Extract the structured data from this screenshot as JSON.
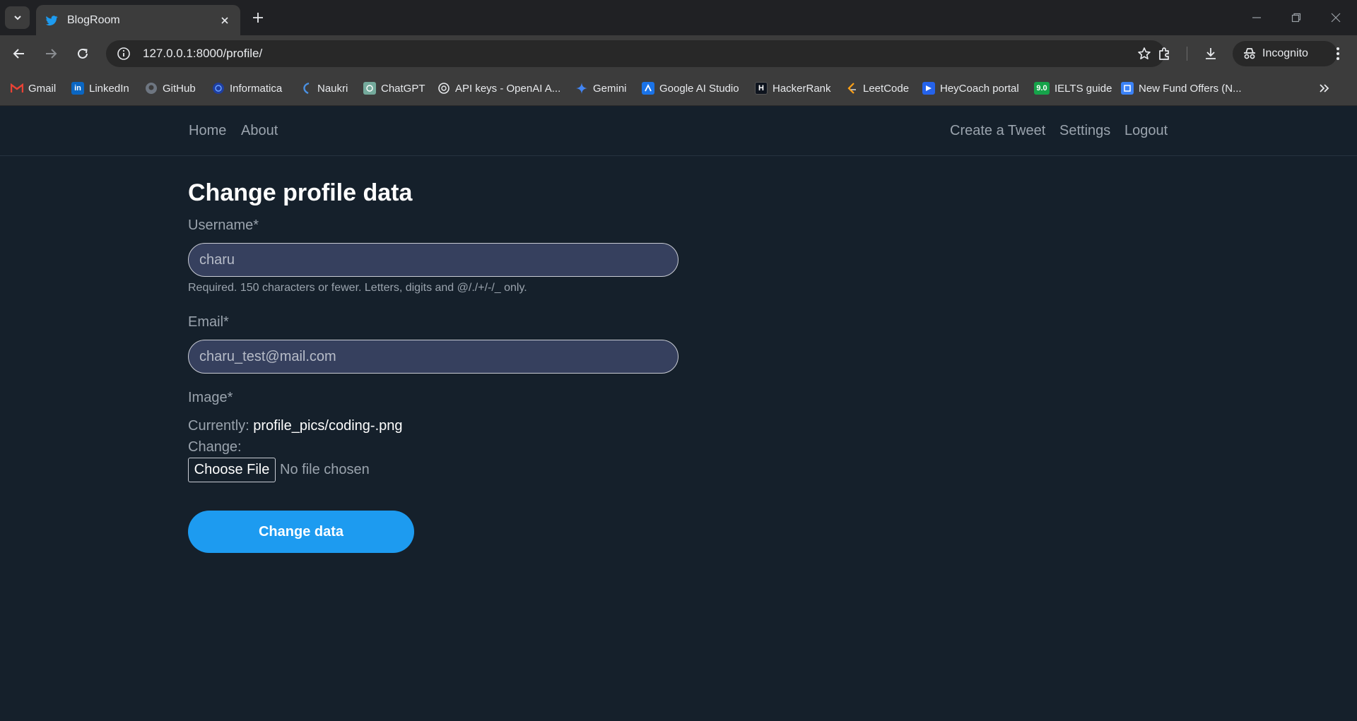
{
  "browser": {
    "tab_title": "BlogRoom",
    "url": "127.0.0.1:8000/profile/",
    "incognito_label": "Incognito",
    "bookmarks": [
      {
        "label": "Gmail",
        "icon": "gmail-icon",
        "color": "#ea4335"
      },
      {
        "label": "LinkedIn",
        "icon": "linkedin-icon",
        "color": "#0a66c2"
      },
      {
        "label": "GitHub",
        "icon": "github-icon",
        "color": "#555555"
      },
      {
        "label": "Informatica",
        "icon": "informatica-icon",
        "color": "#1e3ea0"
      },
      {
        "label": "Naukri",
        "icon": "naukri-icon",
        "color": "#4a90e2"
      },
      {
        "label": "ChatGPT",
        "icon": "chatgpt-icon",
        "color": "#74aa9c"
      },
      {
        "label": "API keys - OpenAI A...",
        "icon": "openai-icon",
        "color": "#202124"
      },
      {
        "label": "Gemini",
        "icon": "gemini-icon",
        "color": "#4285f4"
      },
      {
        "label": "Google AI Studio",
        "icon": "ai-studio-icon",
        "color": "#1a73e8"
      },
      {
        "label": "HackerRank",
        "icon": "hackerrank-icon",
        "color": "#0e141e"
      },
      {
        "label": "LeetCode",
        "icon": "leetcode-icon",
        "color": "#ffa116"
      },
      {
        "label": "HeyCoach portal",
        "icon": "heycoach-icon",
        "color": "#2563eb"
      },
      {
        "label": "IELTS guide",
        "icon": "ielts-icon",
        "color": "#16a34a",
        "badge": "9.0"
      },
      {
        "label": "New Fund Offers (N...",
        "icon": "fund-offers-icon",
        "color": "#3b82f6"
      }
    ]
  },
  "nav": {
    "home": "Home",
    "about": "About",
    "create_tweet": "Create a Tweet",
    "settings": "Settings",
    "logout": "Logout"
  },
  "form": {
    "title": "Change profile data",
    "username_label": "Username*",
    "username_value": "charu",
    "username_help": "Required. 150 characters or fewer. Letters, digits and @/./+/-/_ only.",
    "email_label": "Email*",
    "email_value": "charu_test@mail.com",
    "image_label": "Image*",
    "currently_label": "Currently:",
    "currently_value": "profile_pics/coding-.png",
    "change_label": "Change:",
    "choose_file": "Choose File",
    "no_file": "No file chosen",
    "submit": "Change data"
  },
  "colors": {
    "page_bg": "#15202b",
    "accent": "#1d9bf0",
    "input_bg": "#36405e"
  }
}
